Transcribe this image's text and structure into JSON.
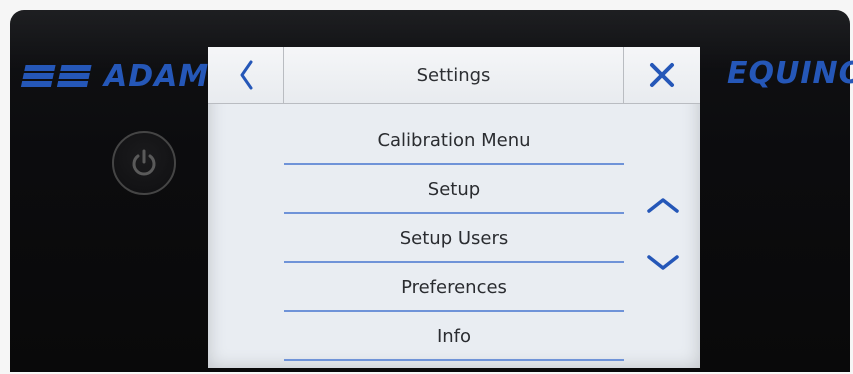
{
  "device": {
    "brand_left": "ADAM",
    "brand_right": "EQUINOX"
  },
  "screen": {
    "title": "Settings",
    "menu": [
      {
        "label": "Calibration Menu"
      },
      {
        "label": "Setup"
      },
      {
        "label": "Setup Users"
      },
      {
        "label": "Preferences"
      },
      {
        "label": "Info"
      }
    ]
  },
  "colors": {
    "accent": "#2557b8",
    "divider": "#6f93d8",
    "screen_bg": "#e9edf2"
  },
  "icons": {
    "back": "chevron-left-icon",
    "close": "close-icon",
    "scroll_up": "chevron-up-icon",
    "scroll_down": "chevron-down-icon",
    "power": "power-icon"
  }
}
